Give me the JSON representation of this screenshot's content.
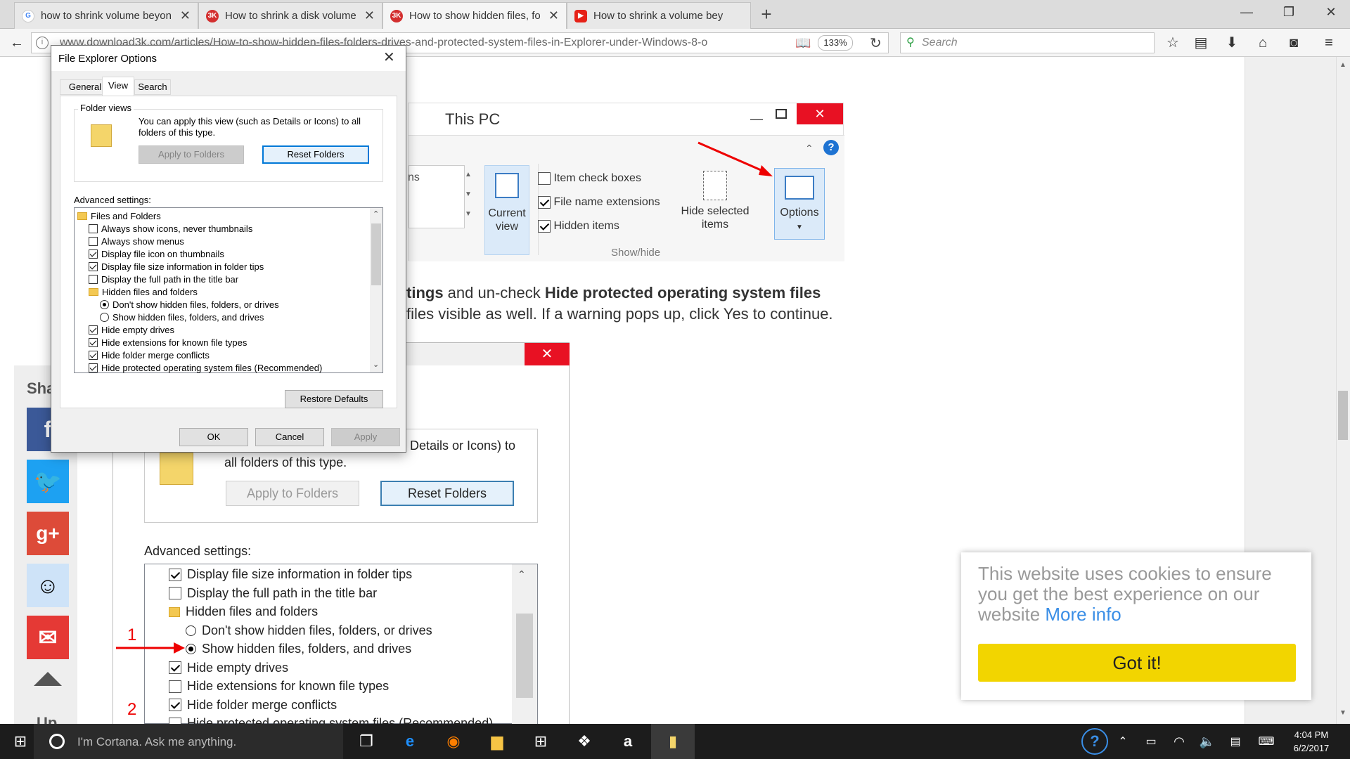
{
  "browser": {
    "tabs": [
      {
        "label": "how to shrink volume beyon",
        "favicon": "G",
        "color": "#4285f4"
      },
      {
        "label": "How to shrink a disk volume",
        "favicon": "3K",
        "color": "#d32f2f"
      },
      {
        "label": "How to show hidden files, fo",
        "favicon": "3K",
        "color": "#d32f2f"
      },
      {
        "label": "How to shrink a volume bey",
        "favicon": "▶",
        "color": "#e62117"
      }
    ],
    "new_tab": "+",
    "url": "www.download3k.com/articles/How-to-show-hidden-files-folders-drives-and-protected-system-files-in-Explorer-under-Windows-8-o",
    "zoom": "133%",
    "search_placeholder": "Search"
  },
  "page": {
    "img1": {
      "title": "This PC",
      "partial_left": "ns",
      "current_view": "Current view",
      "options_items": [
        {
          "label": "Item check boxes",
          "checked": false
        },
        {
          "label": "File name extensions",
          "checked": true
        },
        {
          "label": "Hidden items",
          "checked": true
        }
      ],
      "hide_selected": "Hide selected items",
      "options": "Options",
      "group_label": "Show/hide"
    },
    "line1_a": "tings",
    "line1_b": " and un-check ",
    "line1_c": "Hide protected operating system files",
    "line2": "files visible as well. If a warning pops up, click Yes to continue.",
    "img2": {
      "desc": "Details or Icons) to",
      "desc2": "all folders of this type.",
      "apply_btn": "Apply to Folders",
      "reset_btn": "Reset Folders",
      "adv_label": "Advanced settings:",
      "marker1": "1",
      "marker2": "2",
      "rows": [
        {
          "type": "check",
          "checked": true,
          "label": "Display file size information in folder tips"
        },
        {
          "type": "check",
          "checked": false,
          "label": "Display the full path in the title bar"
        },
        {
          "type": "folder",
          "label": "Hidden files and folders"
        },
        {
          "type": "radio",
          "checked": false,
          "label": "Don't show hidden files, folders, or drives"
        },
        {
          "type": "radio",
          "checked": true,
          "label": "Show hidden files, folders, and drives"
        },
        {
          "type": "check",
          "checked": true,
          "label": "Hide empty drives"
        },
        {
          "type": "check",
          "checked": false,
          "label": "Hide extensions for known file types"
        },
        {
          "type": "check",
          "checked": true,
          "label": "Hide folder merge conflicts"
        },
        {
          "type": "check",
          "checked": false,
          "label": "Hide protected operating system files (Recommended)"
        }
      ]
    },
    "share_label": "Sha",
    "up_label": "Up"
  },
  "cookie": {
    "text": "This website uses cookies to ensure you get the best experience on our website",
    "more_info": "More info",
    "button": "Got it!"
  },
  "dialog": {
    "title": "File Explorer Options",
    "tabs": [
      "General",
      "View",
      "Search"
    ],
    "folder_views_label": "Folder views",
    "folder_views_desc": "You can apply this view (such as Details or Icons) to all folders of this type.",
    "apply_to_folders": "Apply to Folders",
    "reset_folders": "Reset Folders",
    "advanced_label": "Advanced settings:",
    "tree": [
      {
        "type": "folder",
        "indent": 0,
        "label": "Files and Folders"
      },
      {
        "type": "check",
        "indent": 1,
        "checked": false,
        "label": "Always show icons, never thumbnails"
      },
      {
        "type": "check",
        "indent": 1,
        "checked": false,
        "label": "Always show menus"
      },
      {
        "type": "check",
        "indent": 1,
        "checked": true,
        "label": "Display file icon on thumbnails"
      },
      {
        "type": "check",
        "indent": 1,
        "checked": true,
        "label": "Display file size information in folder tips"
      },
      {
        "type": "check",
        "indent": 1,
        "checked": false,
        "label": "Display the full path in the title bar"
      },
      {
        "type": "folder",
        "indent": 1,
        "label": "Hidden files and folders"
      },
      {
        "type": "radio",
        "indent": 2,
        "checked": true,
        "label": "Don't show hidden files, folders, or drives"
      },
      {
        "type": "radio",
        "indent": 2,
        "checked": false,
        "label": "Show hidden files, folders, and drives"
      },
      {
        "type": "check",
        "indent": 1,
        "checked": true,
        "label": "Hide empty drives"
      },
      {
        "type": "check",
        "indent": 1,
        "checked": true,
        "label": "Hide extensions for known file types"
      },
      {
        "type": "check",
        "indent": 1,
        "checked": true,
        "label": "Hide folder merge conflicts"
      },
      {
        "type": "check",
        "indent": 1,
        "checked": true,
        "label": "Hide protected operating system files (Recommended)"
      }
    ],
    "restore_defaults": "Restore Defaults",
    "ok": "OK",
    "cancel": "Cancel",
    "apply": "Apply"
  },
  "taskbar": {
    "cortana": "I'm Cortana. Ask me anything.",
    "time": "4:04 PM",
    "date": "6/2/2017"
  }
}
